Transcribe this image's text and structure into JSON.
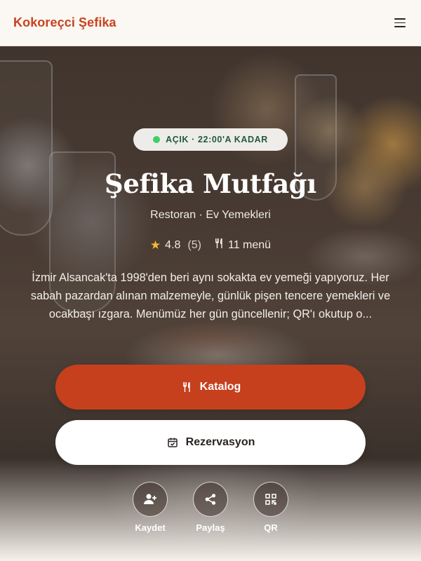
{
  "header": {
    "brand": "Kokoreçci Şefika",
    "menu_icon": "hamburger-menu-icon"
  },
  "status": {
    "text": "AÇIK · 22:00'A KADAR",
    "dot_color": "#3ecf6b"
  },
  "restaurant": {
    "name": "Şefika Mutfağı",
    "category": "Restoran · Ev Yemekleri",
    "rating": "4.8",
    "review_count": "(5)",
    "menu_count": "11 menü",
    "description": "İzmir Alsancak'ta 1998'den beri aynı sokakta ev yemeği yapıyoruz. Her sabah pazardan alınan malzemeyle, günlük pişen tencere yemekleri ve ocakbaşı ızgara. Menümüz her gün güncellenir; QR'ı okutup o..."
  },
  "buttons": {
    "catalog": "Katalog",
    "reservation": "Rezervasyon"
  },
  "actions": [
    {
      "label": "Kaydet",
      "icon": "add-user-icon"
    },
    {
      "label": "Paylaş",
      "icon": "share-icon"
    },
    {
      "label": "QR",
      "icon": "qr-code-icon"
    }
  ],
  "colors": {
    "brand": "#c8421f",
    "primary_button": "#c6401e",
    "rating_star": "#f5b82e"
  }
}
